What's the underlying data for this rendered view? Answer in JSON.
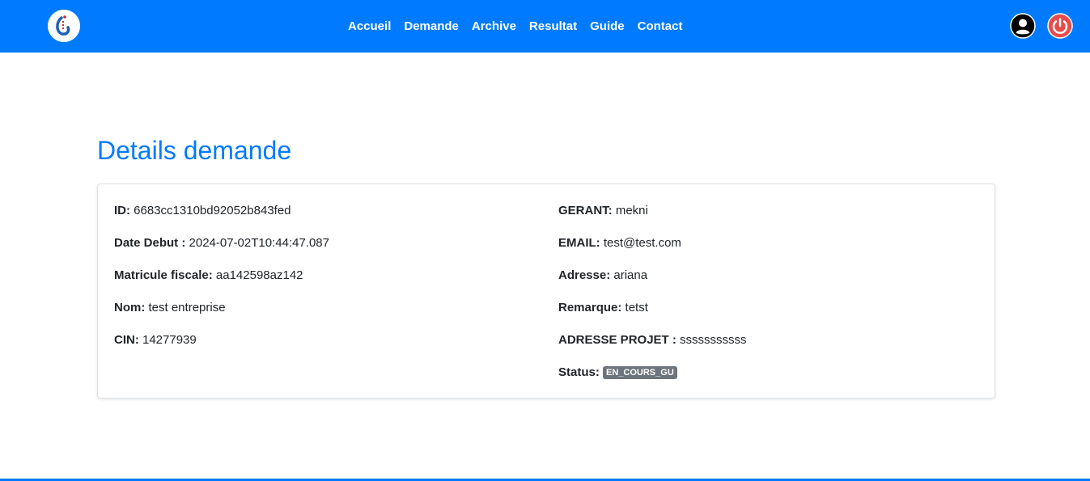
{
  "navbar": {
    "links": [
      "Accueil",
      "Demande",
      "Archive",
      "Resultat",
      "Guide",
      "Contact"
    ],
    "background_color": "#007bff",
    "logo_icon": "logo-icon",
    "user_icon": "user-circle-icon",
    "power_icon": "power-icon"
  },
  "page": {
    "title": "Details demande"
  },
  "details": {
    "left": [
      {
        "label": "ID:",
        "value": "6683cc1310bd92052b843fed"
      },
      {
        "label": "Date Debut :",
        "value": "2024-07-02T10:44:47.087"
      },
      {
        "label": "Matricule fiscale:",
        "value": "aa142598az142"
      },
      {
        "label": "Nom:",
        "value": "test entreprise"
      },
      {
        "label": "CIN:",
        "value": "14277939"
      }
    ],
    "right": [
      {
        "label": "GERANT:",
        "value": "mekni"
      },
      {
        "label": "EMAIL:",
        "value": "test@test.com"
      },
      {
        "label": "Adresse:",
        "value": "ariana"
      },
      {
        "label": "Remarque:",
        "value": "tetst"
      },
      {
        "label": "ADRESSE PROJET :",
        "value": "sssssssssss"
      }
    ],
    "status": {
      "label": "Status:",
      "value": "EN_COURS_GU",
      "badge_color": "#6c757d"
    }
  },
  "colors": {
    "accent": "#007bff",
    "power": "#e94b4b"
  }
}
